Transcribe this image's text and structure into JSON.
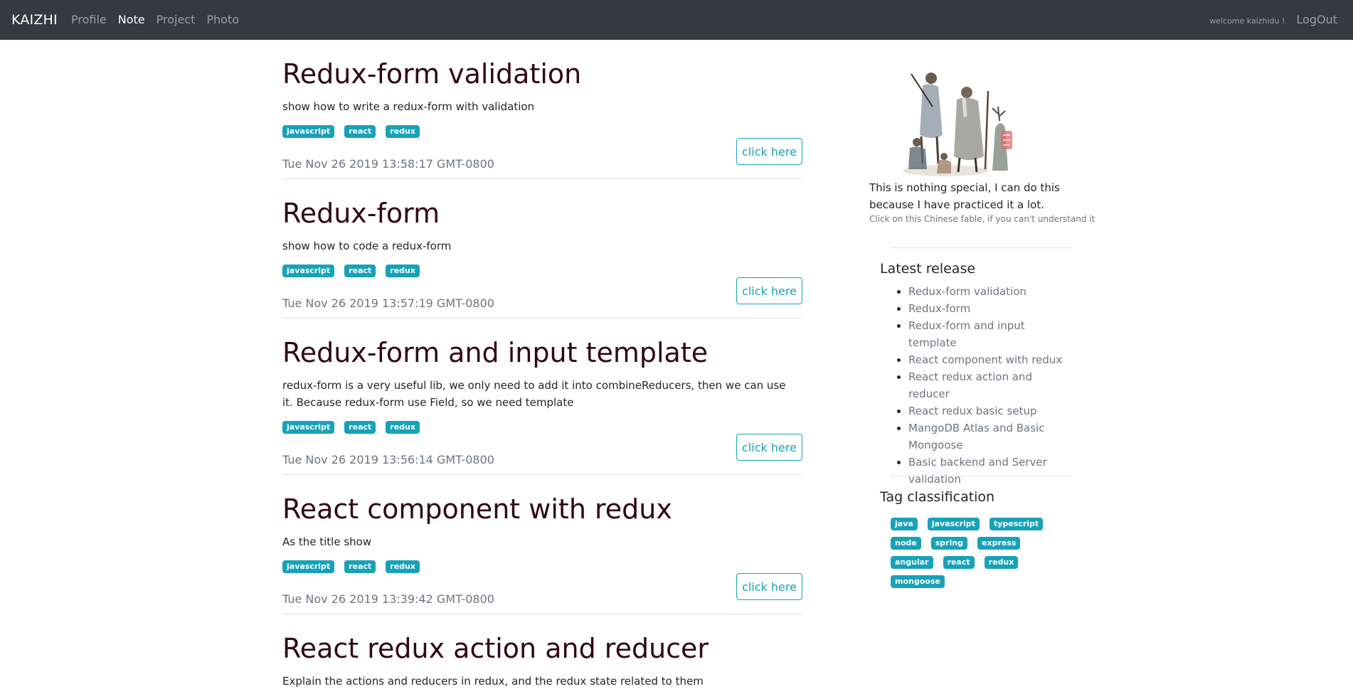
{
  "navbar": {
    "brand": "KAIZHI",
    "links": [
      "Profile",
      "Note",
      "Project",
      "Photo"
    ],
    "welcome": "welcome kaizhidu !",
    "logout": "LogOut"
  },
  "posts": [
    {
      "title": "Redux-form validation",
      "description": "show how to write a redux-form with validation",
      "tags": [
        "javascript",
        "react",
        "redux"
      ],
      "date": "Tue Nov 26 2019 13:58:17 GMT-0800",
      "button": "click here"
    },
    {
      "title": "Redux-form",
      "description": "show how to code a redux-form",
      "tags": [
        "javascript",
        "react",
        "redux"
      ],
      "date": "Tue Nov 26 2019 13:57:19 GMT-0800",
      "button": "click here"
    },
    {
      "title": "Redux-form and input template",
      "description": "redux-form is a very useful lib, we only need to add it into combineReducers, then we can use it. Because redux-form use Field, so we need template",
      "tags": [
        "javascript",
        "react",
        "redux"
      ],
      "date": "Tue Nov 26 2019 13:56:14 GMT-0800",
      "button": "click here"
    },
    {
      "title": "React component with redux",
      "description": "As the title show",
      "tags": [
        "javascript",
        "react",
        "redux"
      ],
      "date": "Tue Nov 26 2019 13:39:42 GMT-0800",
      "button": "click here"
    },
    {
      "title": "React redux action and reducer",
      "description": "Explain the actions and reducers in redux, and the redux state related to them"
    }
  ],
  "sidebar": {
    "fable_text": "This is nothing special, I can do this because I have practiced it a lot.",
    "fable_hint": "Click on this Chinese fable, if you can't understand it",
    "latest_title": "Latest release",
    "latest": [
      "Redux-form validation",
      "Redux-form",
      "Redux-form and input template",
      "React component with redux",
      "React redux action and reducer",
      "React redux basic setup",
      "MangoDB Atlas and Basic Mongoose",
      "Basic backend and Server validation"
    ],
    "tag_title": "Tag classification",
    "tags": [
      [
        "java",
        "javascript",
        "typescript"
      ],
      [
        "node",
        "spring",
        "express"
      ],
      [
        "angular",
        "react",
        "redux"
      ],
      [
        "mongoose"
      ]
    ]
  },
  "colors": {
    "navbar_bg": "#343a40",
    "title": "#300812",
    "tag_bg": "#17a2b8",
    "muted": "#6c757d"
  }
}
